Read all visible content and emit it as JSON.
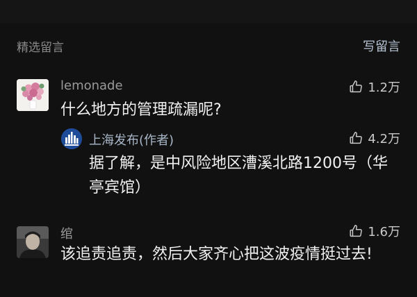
{
  "header": {
    "section_title": "精选留言",
    "write_label": "写留言"
  },
  "comments": [
    {
      "username": "lemonade",
      "text": "什么地方的管理疏漏呢?",
      "likes": "1.2万",
      "reply": {
        "username": "上海发布(作者)",
        "text": "据了解，是中风险地区漕溪北路1200号（华亭宾馆）",
        "likes": "4.2万"
      }
    },
    {
      "username": "绾",
      "text": "该追责追责，然后大家齐心把这波疫情挺过去!",
      "likes": "1.6万"
    }
  ],
  "colors": {
    "background": "#111111",
    "muted_text": "#8a8a8a",
    "accent_link": "#b6c3d3",
    "author_avatar": "#1f4c98"
  }
}
